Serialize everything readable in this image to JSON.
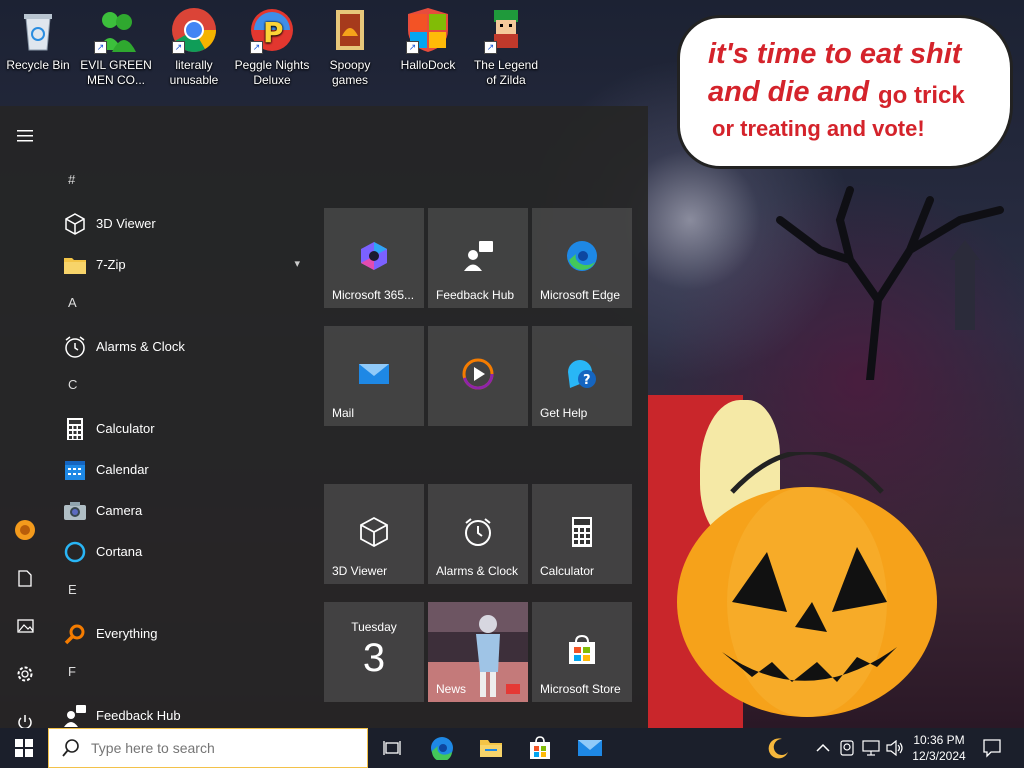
{
  "desktop_icons": [
    {
      "label": "Recycle Bin",
      "icon": "recycle-bin-icon",
      "shortcut": false
    },
    {
      "label": "EVIL GREEN MEN CO...",
      "icon": "green-men-icon",
      "shortcut": true
    },
    {
      "label": "literally unusable",
      "icon": "chrome-icon",
      "shortcut": true
    },
    {
      "label": "Peggle Nights Deluxe",
      "icon": "peggle-icon",
      "shortcut": true
    },
    {
      "label": "Spoopy games",
      "icon": "folder-icon",
      "shortcut": false
    },
    {
      "label": "HalloDock",
      "icon": "windows-shield-icon",
      "shortcut": true
    },
    {
      "label": "The Legend of Zilda",
      "icon": "zilda-icon",
      "shortcut": true
    }
  ],
  "wallpaper": {
    "speech_line1": "it's time to eat shit",
    "speech_line2a": "and die and",
    "speech_line2b": "go trick",
    "speech_line3": "or treating and vote!",
    "speech_color": "#d4232b"
  },
  "start_menu": {
    "rail": [
      "hamburger-menu-icon",
      "user-avatar-icon",
      "documents-icon",
      "pictures-icon",
      "settings-icon",
      "power-icon"
    ],
    "app_list": [
      {
        "type": "letter",
        "text": "#"
      },
      {
        "type": "app",
        "text": "3D Viewer",
        "icon": "3d-viewer-icon"
      },
      {
        "type": "app",
        "text": "7-Zip",
        "icon": "folder-icon",
        "expandable": true
      },
      {
        "type": "letter",
        "text": "A"
      },
      {
        "type": "app",
        "text": "Alarms & Clock",
        "icon": "alarm-clock-icon"
      },
      {
        "type": "letter",
        "text": "C"
      },
      {
        "type": "app",
        "text": "Calculator",
        "icon": "calculator-icon"
      },
      {
        "type": "app",
        "text": "Calendar",
        "icon": "calendar-icon"
      },
      {
        "type": "app",
        "text": "Camera",
        "icon": "camera-icon"
      },
      {
        "type": "app",
        "text": "Cortana",
        "icon": "cortana-icon"
      },
      {
        "type": "letter",
        "text": "E"
      },
      {
        "type": "app",
        "text": "Everything",
        "icon": "search-icon"
      },
      {
        "type": "letter",
        "text": "F"
      },
      {
        "type": "app",
        "text": "Feedback Hub",
        "icon": "feedback-hub-icon"
      }
    ],
    "tiles": [
      {
        "label": "Microsoft 365...",
        "icon": "microsoft-365-icon"
      },
      {
        "label": "Feedback Hub",
        "icon": "feedback-hub-icon"
      },
      {
        "label": "Microsoft Edge",
        "icon": "edge-icon"
      },
      {
        "label": "Mail",
        "icon": "mail-icon"
      },
      {
        "label": "",
        "icon": "media-player-icon"
      },
      {
        "label": "Get Help",
        "icon": "get-help-icon"
      },
      {
        "label": "3D Viewer",
        "icon": "3d-viewer-icon"
      },
      {
        "label": "Alarms & Clock",
        "icon": "alarm-clock-icon"
      },
      {
        "label": "Calculator",
        "icon": "calculator-icon"
      },
      {
        "label": "",
        "day": "Tuesday",
        "date": "3",
        "icon": "calendar-tile"
      },
      {
        "label": "News",
        "icon": "news-icon"
      },
      {
        "label": "Microsoft Store",
        "icon": "store-icon"
      }
    ]
  },
  "taskbar": {
    "search_placeholder": "Type here to search",
    "pinned": [
      "task-view-icon",
      "edge-icon",
      "file-explorer-icon",
      "store-icon",
      "mail-icon"
    ],
    "tray_icons": [
      "moon-icon",
      "chevron-up-icon",
      "webcam-icon",
      "network-icon",
      "volume-icon"
    ],
    "time": "10:36 PM",
    "date": "12/3/2024",
    "notification_icon": "notification-icon"
  }
}
